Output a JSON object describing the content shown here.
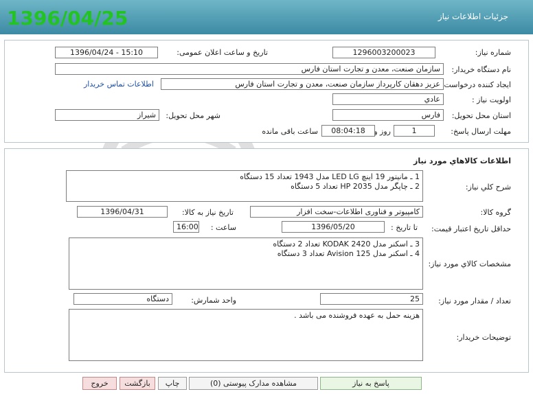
{
  "header": {
    "title": "جزئیات اطلاعات نیاز",
    "date": "1396/04/25"
  },
  "info": {
    "need_number_label": "شماره نیاز:",
    "need_number": "1296003200023",
    "announce_label": "تاریخ و ساعت اعلان عمومی:",
    "announce_value": "1396/04/24 - 15:10",
    "buyer_org_label": "نام دستگاه خریدار:",
    "buyer_org": "سازمان صنعت، معدن و تجارت استان فارس",
    "creator_label": "ایجاد کننده درخواست:",
    "creator": "عزیز دهقان کارپرداز سازمان صنعت، معدن و تجارت استان فارس",
    "contact_link": "اطلاعات تماس خریدار",
    "priority_label": "اولویت نیاز :",
    "priority": "عادي",
    "province_label": "استان محل تحویل:",
    "province": "فارس",
    "city_label": "شهر محل تحویل:",
    "city": "شیراز",
    "deadline_label": "مهلت ارسال پاسخ:",
    "days": "1",
    "days_word": "روز و",
    "time_left": "08:04:18",
    "time_left_word": "ساعت باقی مانده"
  },
  "goods": {
    "section_title": "اطلاعات کالاهاي مورد نياز",
    "summary_label": "شرح کلي نياز:",
    "summary_lines": [
      "1 ـ مانیتور 19 اینچ LED  LG  مدل 1943 تعداد 15 دستگاه",
      "2 ـ چاپگر مدل HP  2035    تعداد 5 دستگاه"
    ],
    "group_label": "گروه کالا:",
    "group": "کامپیوتر و فناوری اطلاعات-سخت افزار",
    "need_date_label": "تاریخ نیاز به کالا:",
    "need_date": "1396/04/31",
    "price_valid_label": "حداقل تاریخ اعتبار قیمت:",
    "to_date_label": "تا تاریخ :",
    "to_date": "1396/05/20",
    "hour_label": "ساعت :",
    "hour": "16:00",
    "spec_label": "مشخصات کالاي مورد نياز:",
    "spec_lines": [
      "3 ـ اسکنر مدل KODAK 2420  تعداد 2 دستگاه",
      "4 ـ اسکنر مدل Avision 125   تعداد 3 دستگاه"
    ],
    "qty_label": "تعداد / مقدار مورد نیاز:",
    "qty": "25",
    "unit_label": "واحد شمارش:",
    "unit": "دستگاه",
    "notes_label": "توضیحات خریدار:",
    "notes": "هزینه حمل به عهده فروشنده می باشد ."
  },
  "buttons": {
    "reply": "پاسخ به نیاز",
    "attachments": "مشاهده مدارک پیوستی (0)",
    "print": "چاپ",
    "back": "بازگشت",
    "exit": "خروج"
  },
  "colors": {
    "header_top": "#6fb6c7",
    "header_bottom": "#3c8aa4",
    "date_green": "#22c322",
    "link_blue": "#1e4fa6"
  }
}
